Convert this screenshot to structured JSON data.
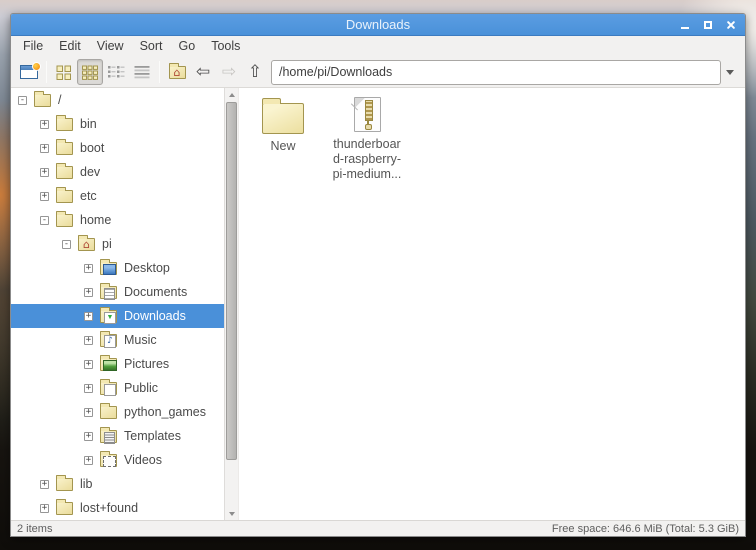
{
  "window": {
    "title": "Downloads"
  },
  "menubar": {
    "items": [
      "File",
      "Edit",
      "View",
      "Sort",
      "Go",
      "Tools"
    ]
  },
  "toolbar": {
    "path_value": "/home/pi/Downloads",
    "active_view": "thumbnail-view",
    "icons": [
      "new-window-icon",
      "icon-view-icon",
      "thumbnail-view-icon",
      "compact-view-icon",
      "detailed-view-icon",
      "home-icon",
      "back-arrow-icon",
      "forward-arrow-icon",
      "up-arrow-icon",
      "dropdown-chevron-icon"
    ],
    "back_glyph": "⇦",
    "forward_glyph": "⇨",
    "up_glyph": "⇧"
  },
  "tree": {
    "items": [
      {
        "label": "/",
        "icon": "folder-icon",
        "level": 0,
        "expander": "-",
        "selected": false
      },
      {
        "label": "bin",
        "icon": "folder-icon",
        "level": 1,
        "expander": "+",
        "selected": false
      },
      {
        "label": "boot",
        "icon": "folder-icon",
        "level": 1,
        "expander": "+",
        "selected": false
      },
      {
        "label": "dev",
        "icon": "folder-icon",
        "level": 1,
        "expander": "+",
        "selected": false
      },
      {
        "label": "etc",
        "icon": "folder-icon",
        "level": 1,
        "expander": "+",
        "selected": false
      },
      {
        "label": "home",
        "icon": "folder-icon",
        "level": 1,
        "expander": "-",
        "selected": false
      },
      {
        "label": "pi",
        "icon": "home-folder-icon",
        "level": 2,
        "expander": "-",
        "selected": false
      },
      {
        "label": "Desktop",
        "icon": "desktop-folder-icon",
        "level": 3,
        "expander": "+",
        "selected": false
      },
      {
        "label": "Documents",
        "icon": "documents-folder-icon",
        "level": 3,
        "expander": "+",
        "selected": false
      },
      {
        "label": "Downloads",
        "icon": "downloads-folder-icon",
        "level": 3,
        "expander": "+",
        "selected": true
      },
      {
        "label": "Music",
        "icon": "music-folder-icon",
        "level": 3,
        "expander": "+",
        "selected": false
      },
      {
        "label": "Pictures",
        "icon": "pictures-folder-icon",
        "level": 3,
        "expander": "+",
        "selected": false
      },
      {
        "label": "Public",
        "icon": "public-folder-icon",
        "level": 3,
        "expander": "+",
        "selected": false
      },
      {
        "label": "python_games",
        "icon": "folder-icon",
        "level": 3,
        "expander": "+",
        "selected": false
      },
      {
        "label": "Templates",
        "icon": "templates-folder-icon",
        "level": 3,
        "expander": "+",
        "selected": false
      },
      {
        "label": "Videos",
        "icon": "videos-folder-icon",
        "level": 3,
        "expander": "+",
        "selected": false
      },
      {
        "label": "lib",
        "icon": "folder-icon",
        "level": 1,
        "expander": "+",
        "selected": false
      },
      {
        "label": "lost+found",
        "icon": "folder-icon",
        "level": 1,
        "expander": "+",
        "selected": false
      }
    ]
  },
  "files": {
    "items": [
      {
        "icon": "folder-icon",
        "label_lines": [
          "New",
          "",
          ""
        ]
      },
      {
        "icon": "zip-file-icon",
        "label_lines": [
          "thunderboar",
          "d-raspberry-",
          "pi-medium..."
        ]
      }
    ]
  },
  "statusbar": {
    "items_count": "2 items",
    "free_space": "Free space: 646.6 MiB (Total: 5.3 GiB)"
  },
  "colors": {
    "titlebar_blue": "#4a91d9",
    "selection_blue": "#4a90d9",
    "chrome_bg": "#f2f1f0",
    "folder_fill": "#f3e9b4",
    "folder_border": "#a3954f",
    "status_text": "#5e5e5e"
  }
}
